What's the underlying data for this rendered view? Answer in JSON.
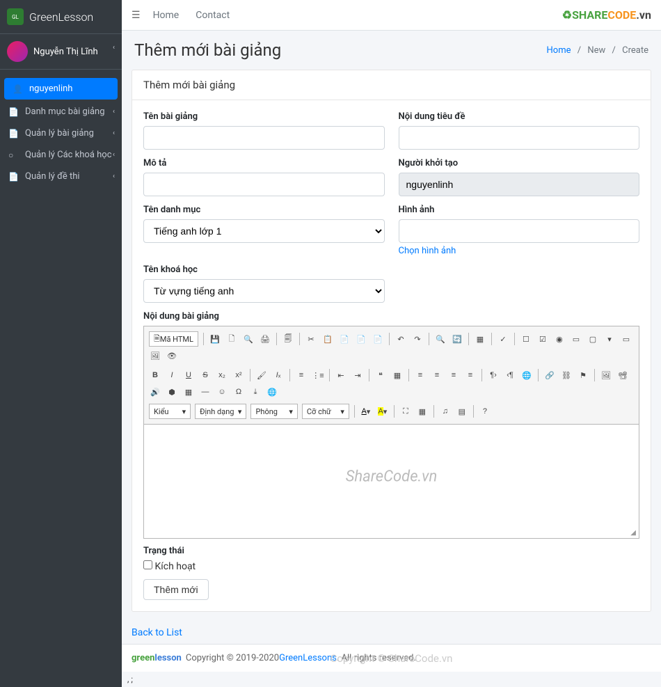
{
  "brand": {
    "name": "GreenLesson"
  },
  "user": {
    "display_name": "Nguyễn Thị Lĩnh",
    "username": "nguyenlinh"
  },
  "sidebar": {
    "items": [
      {
        "label": "nguyenlinh"
      },
      {
        "label": "Danh mục bài giảng"
      },
      {
        "label": "Quản lý bài giảng"
      },
      {
        "label": "Quản lý Các khoá học"
      },
      {
        "label": "Quản lý đề thi"
      }
    ]
  },
  "topnav": {
    "home": "Home",
    "contact": "Contact",
    "sharecode": "SHARECODE.vn"
  },
  "page": {
    "title": "Thêm mới bài giảng",
    "breadcrumb": {
      "home": "Home",
      "new": "New",
      "create": "Create"
    }
  },
  "card": {
    "title": "Thêm mới bài giảng"
  },
  "form": {
    "lesson_name_label": "Tên bài giảng",
    "title_content_label": "Nội dung tiêu đề",
    "desc_label": "Mô tả",
    "creator_label": "Người khởi tạo",
    "creator_value": "nguyenlinh",
    "category_label": "Tên danh mục",
    "category_value": "Tiếng anh lớp 1",
    "image_label": "Hình ảnh",
    "choose_image": "Chọn hình ảnh",
    "course_label": "Tên khoá học",
    "course_value": "Từ vựng tiếng anh",
    "content_label": "Nội dung bài giảng",
    "status_label": "Trạng thái",
    "activate_label": "Kích hoạt",
    "submit_label": "Thêm mới"
  },
  "cke": {
    "source": "Mã HTML",
    "style": "Kiểu",
    "format": "Định dạng",
    "font": "Phông",
    "size": "Cỡ chữ"
  },
  "back_link": "Back to List",
  "footer": {
    "copyright": "Copyright © 2019-2020 ",
    "brand_link": "GreenLessons",
    "rights": ". All rights reserved."
  },
  "watermarks": {
    "body": "ShareCode.vn",
    "footer": "Copyright © ShareCode.vn"
  }
}
